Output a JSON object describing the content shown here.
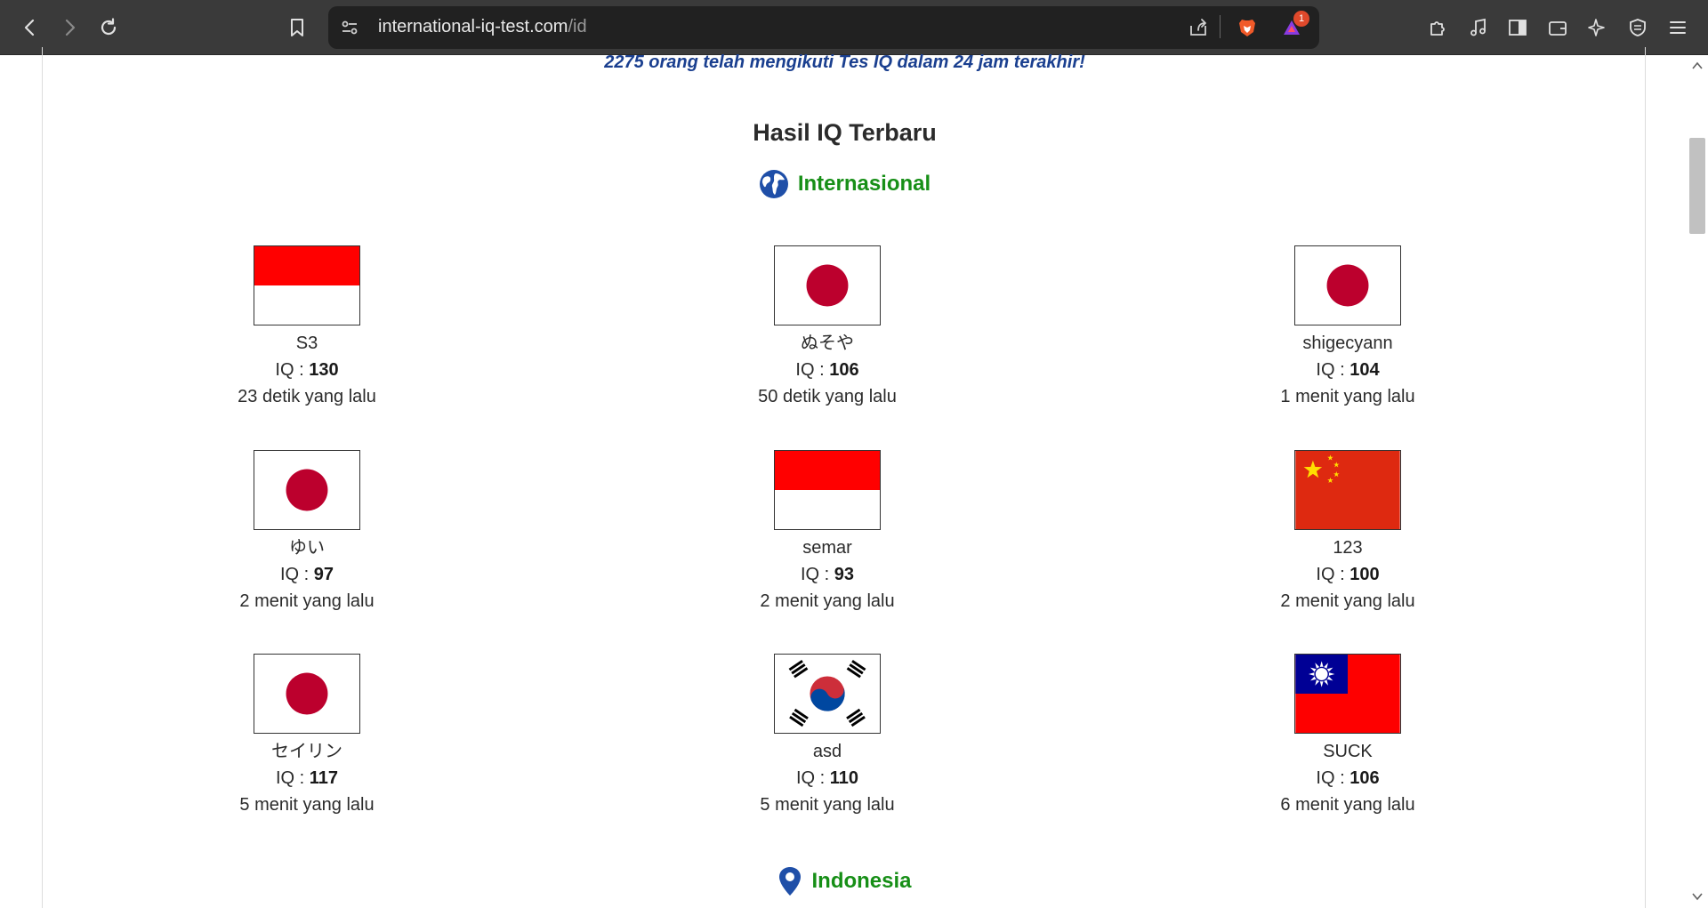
{
  "browser": {
    "url_host": "international-iq-test.com",
    "url_path": "/id",
    "notification_count": "1"
  },
  "page": {
    "visitors_text": "2275 orang telah mengikuti Tes IQ dalam 24 jam terakhir!",
    "section_title": "Hasil IQ Terbaru",
    "international_label": "Internasional",
    "indonesia_label": "Indonesia",
    "iq_prefix": "IQ : ",
    "results": [
      {
        "name": "S3",
        "iq": "130",
        "time": "23 detik yang lalu",
        "flag": "indonesia"
      },
      {
        "name": "ぬそや",
        "iq": "106",
        "time": "50 detik yang lalu",
        "flag": "japan"
      },
      {
        "name": "shigecyann",
        "iq": "104",
        "time": "1 menit yang lalu",
        "flag": "japan"
      },
      {
        "name": "ゆい",
        "iq": "97",
        "time": "2 menit yang lalu",
        "flag": "japan"
      },
      {
        "name": "semar",
        "iq": "93",
        "time": "2 menit yang lalu",
        "flag": "indonesia"
      },
      {
        "name": "123",
        "iq": "100",
        "time": "2 menit yang lalu",
        "flag": "china"
      },
      {
        "name": "セイリン",
        "iq": "117",
        "time": "5 menit yang lalu",
        "flag": "japan"
      },
      {
        "name": "asd",
        "iq": "110",
        "time": "5 menit yang lalu",
        "flag": "south-korea"
      },
      {
        "name": "SUCK",
        "iq": "106",
        "time": "6 menit yang lalu",
        "flag": "taiwan"
      }
    ]
  },
  "colors": {
    "visitors_text": "#1a3f8f",
    "section_label": "#178f17",
    "japan_red": "#bc002d",
    "indonesia_red": "#ff0000",
    "china_red": "#de2910",
    "taiwan_blue": "#000095"
  }
}
